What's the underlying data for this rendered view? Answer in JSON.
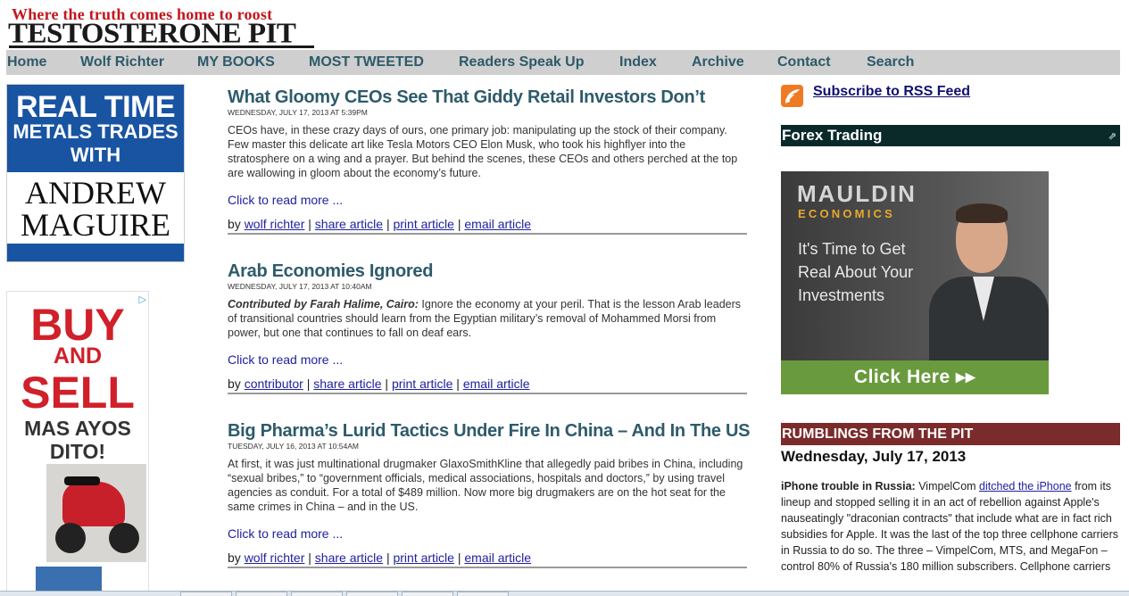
{
  "header": {
    "tagline": "Where the truth comes home to roost",
    "site_name": "TESTOSTERONE PIT"
  },
  "nav": {
    "items": [
      {
        "label": "Home"
      },
      {
        "label": "Wolf Richter"
      },
      {
        "label": "MY BOOKS"
      },
      {
        "label": "MOST TWEETED"
      },
      {
        "label": "Readers Speak Up"
      },
      {
        "label": "Index"
      },
      {
        "label": "Archive"
      },
      {
        "label": "Contact"
      },
      {
        "label": "Search"
      }
    ]
  },
  "left_ads": {
    "ad1": {
      "line1": "REAL TIME",
      "line2": "METALS TRADES",
      "line3": "WITH",
      "line4": "ANDREW",
      "line5": "MAGUIRE"
    },
    "ad2": {
      "line1": "BUY",
      "line2": "AND",
      "line3": "SELL",
      "line4": "MAS AYOS",
      "line5": "DITO!"
    }
  },
  "articles": [
    {
      "title": "What Gloomy CEOs See That Giddy Retail Investors Don’t",
      "date": "WEDNESDAY, JULY 17, 2013 AT 5:39PM",
      "lead": "",
      "text": "CEOs have, in these crazy days of ours, one primary job: manipulating up the stock of their company. Few master this delicate art like Tesla Motors CEO Elon Musk, who took his highflyer into the stratosphere on a wing and a prayer. But behind the scenes, these CEOs and others perched at the top are wallowing in gloom about the economy’s future.",
      "more": "Click to read more ...",
      "by": "by",
      "author": "wolf richter",
      "share": "share article",
      "print": "print article",
      "email": "email article"
    },
    {
      "title": "Arab Economies Ignored",
      "date": "WEDNESDAY, JULY 17, 2013 AT 10:40AM",
      "lead": "Contributed by Farah Halime, Cairo:",
      "text": " Ignore the economy at your peril. That is the lesson Arab leaders of transitional countries should learn from the Egyptian military’s removal of Mohammed Morsi from power, but one that continues to fall on deaf ears.",
      "more": "Click to read more ...",
      "by": "by",
      "author": "contributor",
      "share": "share article",
      "print": "print article",
      "email": "email article"
    },
    {
      "title": "Big Pharma’s Lurid Tactics Under Fire In China – And In The US",
      "date": "TUESDAY, JULY 16, 2013 AT 10:54AM",
      "lead": "",
      "text": "At first, it was just multinational drugmaker GlaxoSmithKline that allegedly paid bribes in China, including “sexual bribes,” to “government officials, medical associations, hospitals and doctors,” by using travel agencies as conduit. For a total of $489 million. Now more big drugmakers are on the hot seat for the same crimes in China – and in the US.",
      "more": "Click to read more ...",
      "by": "by",
      "author": "wolf richter",
      "share": "share article",
      "print": "print article",
      "email": "email article"
    }
  ],
  "sidebar": {
    "rss_label": "Subscribe to RSS Feed",
    "forex_title": "Forex Trading",
    "mauldin": {
      "brand": "MAULDIN",
      "sub": "ECONOMICS",
      "pitch1": "It's Time to Get",
      "pitch2": "Real About Your",
      "pitch3": "Investments",
      "cta": "Click Here ▸▸"
    },
    "rumblings_title": "RUMBLINGS FROM THE PIT",
    "rumblings_date": "Wednesday, July 17, 2013",
    "rumblings_lead": "iPhone trouble in Russia:",
    "rumblings_pre": " VimpelCom ",
    "rumblings_link": "ditched the iPhone",
    "rumblings_text": " from its lineup and stopped selling it in an act of rebellion against Apple's nauseatingly \"draconian contracts\" that include what are in fact rich subsidies for Apple. It was the last of the top three cellphone carriers in Russia to do so. The three – VimpelCom, MTS, and MegaFon – control 80% of Russia's 180 million subscribers. Cellphone carriers"
  },
  "colors": {
    "nav_bg": "#cfcfcf",
    "nav_text": "#2d5a6a",
    "title_color": "#2e5b6b",
    "link_color": "#2020a0",
    "forex_bg": "#0a2a2a",
    "rumblings_bg": "#7b2b2b",
    "ad_blue": "#1954a3",
    "ad_red": "#d0202a"
  }
}
